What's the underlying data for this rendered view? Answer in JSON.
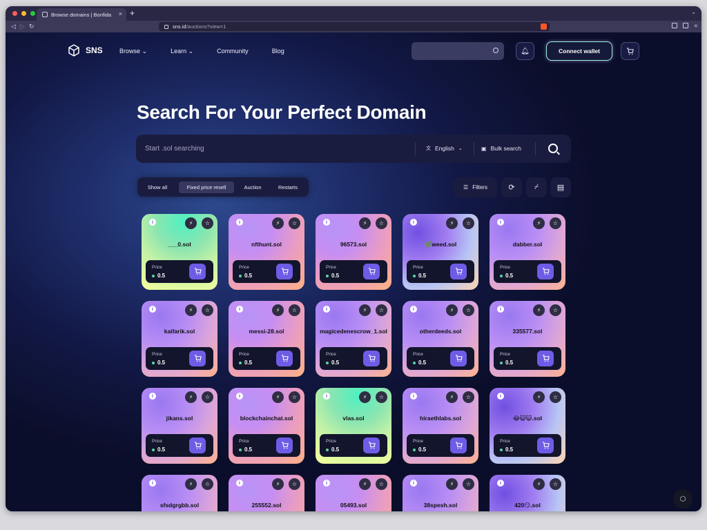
{
  "browser": {
    "tab_title": "Browse domains | Bonfida",
    "url_host": "sns.id",
    "url_path": "/auctions?view=1",
    "new_tab": "+",
    "tab_close": "×"
  },
  "nav": {
    "brand": "SNS",
    "links": [
      "Browse",
      "Learn",
      "Community",
      "Blog"
    ],
    "connect_label": "Connect wallet"
  },
  "hero": {
    "title": "Search For Your Perfect Domain",
    "search_placeholder": "Start .sol searching",
    "language": "English",
    "bulk_label": "Bulk search"
  },
  "segments": [
    "Show all",
    "Fixed price resell",
    "Auction",
    "Restarts"
  ],
  "active_segment": "Fixed price resell",
  "filters_label": "Filters",
  "cards": [
    {
      "name": "___0.sol",
      "price_label": "Price",
      "price": "0.5",
      "style": "green"
    },
    {
      "name": "nfthunt.sol",
      "price_label": "Price",
      "price": "0.5",
      "style": "pink"
    },
    {
      "name": "96573.sol",
      "price_label": "Price",
      "price": "0.5",
      "style": "pink"
    },
    {
      "name": "🌿weed.sol",
      "price_label": "Price",
      "price": "0.5",
      "style": "blue"
    },
    {
      "name": "dabber.sol",
      "price_label": "Price",
      "price": "0.5",
      "style": "purple"
    },
    {
      "name": "kaifarik.sol",
      "price_label": "Price",
      "price": "0.5",
      "style": "purple"
    },
    {
      "name": "messi-28.sol",
      "price_label": "Price",
      "price": "0.5",
      "style": "pink"
    },
    {
      "name": "magicedenescrow_1.sol",
      "price_label": "Price",
      "price": "0.5",
      "style": "purple"
    },
    {
      "name": "otherdeeds.sol",
      "price_label": "Price",
      "price": "0.5",
      "style": "purple"
    },
    {
      "name": "335577.sol",
      "price_label": "Price",
      "price": "0.5",
      "style": "purple"
    },
    {
      "name": "jikans.sol",
      "price_label": "Price",
      "price": "0.5",
      "style": "purple"
    },
    {
      "name": "blockchainchat.sol",
      "price_label": "Price",
      "price": "0.5",
      "style": "pink"
    },
    {
      "name": "vlas.sol",
      "price_label": "Price",
      "price": "0.5",
      "style": "green"
    },
    {
      "name": "hiraethlabs.sol",
      "price_label": "Price",
      "price": "0.5",
      "style": "purple"
    },
    {
      "name": "😂😺😺.sol",
      "price_label": "Price",
      "price": "0.5",
      "style": "blue"
    },
    {
      "name": "sfsdgrgbb.sol",
      "price_label": "Price",
      "price": "0.5",
      "style": "purple"
    },
    {
      "name": "255552.sol",
      "price_label": "Price",
      "price": "0.5",
      "style": "pink"
    },
    {
      "name": "05493.sol",
      "price_label": "Price",
      "price": "0.5",
      "style": "pink"
    },
    {
      "name": "38spesh.sol",
      "price_label": "Price",
      "price": "0.5",
      "style": "purple"
    },
    {
      "name": "420😏.sol",
      "price_label": "Price",
      "price": "0.5",
      "style": "blue"
    }
  ],
  "colors": {
    "accent": "#6f5ce6",
    "connect_border": "#9ef5d8",
    "page_bg": "#0b0e2a"
  }
}
